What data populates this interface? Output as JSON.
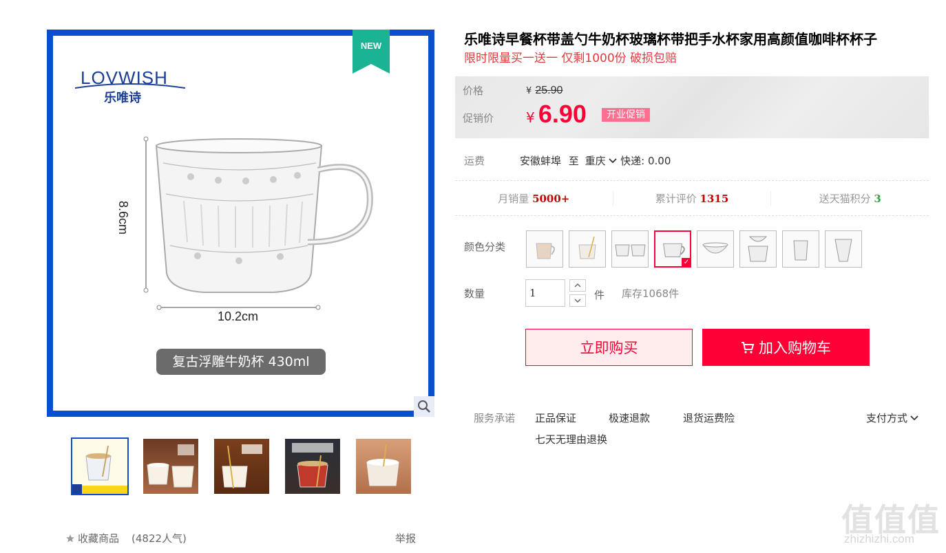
{
  "gallery": {
    "new_badge": "NEW",
    "logo_en": "LOVWISH",
    "logo_cn": "乐唯诗",
    "dim_height": "8.6cm",
    "dim_width": "10.2cm",
    "caption": "复古浮雕牛奶杯 430ml",
    "thumb_count": 5,
    "favorite_label": "收藏商品",
    "favorite_count": "(4822人气)",
    "report_label": "举报"
  },
  "product": {
    "title": "乐唯诗早餐杯带盖勺牛奶杯玻璃杯带把手水杯家用高颜值咖啡杯杯子",
    "subtitle": "限时限量买一送一 仅剩1000份 破损包赔"
  },
  "price": {
    "label": "价格",
    "currency": "¥",
    "original": "25.90",
    "promo_label": "促销价",
    "current": "6.90",
    "promo_tag": "开业促销"
  },
  "shipping": {
    "label": "运费",
    "from": "安徽蚌埠",
    "to_word": "至",
    "to": "重庆",
    "express": "快递: 0.00"
  },
  "stats": {
    "monthly_label": "月销量",
    "monthly_value": "5000+",
    "reviews_label": "累计评价",
    "reviews_value": "1315",
    "points_label": "送天猫积分",
    "points_value": "3"
  },
  "options": {
    "color_label": "颜色分类",
    "swatch_count": 8,
    "selected_index": 3
  },
  "quantity": {
    "label": "数量",
    "value": "1",
    "unit": "件",
    "stock": "库存1068件"
  },
  "actions": {
    "buy_now": "立即购买",
    "add_to_cart": "加入购物车"
  },
  "service": {
    "label": "服务承诺",
    "items": [
      "正品保证",
      "极速退款",
      "退货运费险",
      "七天无理由退换"
    ],
    "payment": "支付方式"
  },
  "watermark": {
    "big": "值值值",
    "small": "zhizhizhi.com"
  },
  "colors": {
    "accent": "#ff0036",
    "frame_blue": "#0a4fd0",
    "badge_green": "#1ab394"
  }
}
